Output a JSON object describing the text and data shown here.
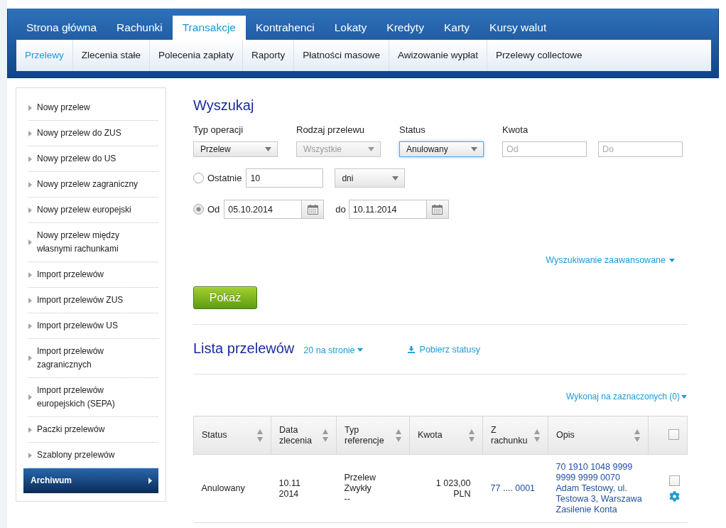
{
  "header": {
    "tabs": [
      {
        "label": "Strona główna",
        "selected": false
      },
      {
        "label": "Rachunki",
        "selected": false
      },
      {
        "label": "Transakcje",
        "selected": true
      },
      {
        "label": "Kontrahenci",
        "selected": false
      },
      {
        "label": "Lokaty",
        "selected": false
      },
      {
        "label": "Kredyty",
        "selected": false
      },
      {
        "label": "Karty",
        "selected": false
      },
      {
        "label": "Kursy walut",
        "selected": false
      }
    ],
    "subtabs": [
      {
        "label": "Przelewy",
        "selected": true
      },
      {
        "label": "Zlecenia stałe",
        "selected": false
      },
      {
        "label": "Polecenia zapłaty",
        "selected": false
      },
      {
        "label": "Raporty",
        "selected": false
      },
      {
        "label": "Płatności masowe",
        "selected": false
      },
      {
        "label": "Awizowanie wypłat",
        "selected": false
      },
      {
        "label": "Przelewy collectowe",
        "selected": false
      }
    ]
  },
  "sidebar": {
    "items": [
      {
        "label": "Nowy przelew",
        "selected": false
      },
      {
        "label": "Nowy przelew do ZUS",
        "selected": false
      },
      {
        "label": "Nowy przelew do US",
        "selected": false
      },
      {
        "label": "Nowy przelew zagraniczny",
        "selected": false
      },
      {
        "label": "Nowy przelew europejski",
        "selected": false
      },
      {
        "label": "Nowy przelew między własnymi rachunkami",
        "selected": false
      },
      {
        "label": "Import przelewów",
        "selected": false
      },
      {
        "label": "Import przelewów ZUS",
        "selected": false
      },
      {
        "label": "Import przelewów US",
        "selected": false
      },
      {
        "label": "Import przelewów zagranicznych",
        "selected": false
      },
      {
        "label": "Import przelewów europejskich (SEPA)",
        "selected": false
      },
      {
        "label": "Paczki przelewów",
        "selected": false
      },
      {
        "label": "Szablony przelewów",
        "selected": false
      },
      {
        "label": "Archiwum",
        "selected": true
      }
    ]
  },
  "search": {
    "title": "Wyszukaj",
    "filters": [
      {
        "kind": "select",
        "label": "Typ operacji",
        "value": "Przelew",
        "disabled": false,
        "focused": false
      },
      {
        "kind": "select",
        "label": "Rodzaj przelewu",
        "value": "Wszystkie",
        "disabled": true,
        "focused": false
      },
      {
        "kind": "select",
        "label": "Status",
        "value": "Anulowany",
        "disabled": false,
        "focused": true
      },
      {
        "kind": "range",
        "label": "Kwota",
        "from_placeholder": "Od",
        "to_placeholder": "Do"
      }
    ],
    "date_options": [
      {
        "kind": "last",
        "label": "Ostatnie",
        "selected": false,
        "value": "10",
        "unit": "dni"
      },
      {
        "kind": "range",
        "label": "Od",
        "selected": true,
        "from": "05.10.2014",
        "to_label": "do",
        "to": "10.11.2014"
      }
    ],
    "advanced_link": "Wyszukiwanie zaawansowane",
    "submit": "Pokaż"
  },
  "transfers": {
    "title": "Lista przelewów",
    "page_size": "20 na stronie",
    "download": "Pobierz statusy",
    "bulk_action": "Wykonaj na zaznaczonych (0)",
    "table": {
      "columns": [
        "Status",
        "Data zlecenia",
        "Typ referencje",
        "Kwota",
        "Z rachunku",
        "Opis"
      ],
      "select_all": {
        "checked": false
      },
      "rows": [
        {
          "status": "Anulowany",
          "date": [
            "10.11",
            "2014"
          ],
          "type": [
            "Przelew",
            "Zwykły",
            "--"
          ],
          "amount": [
            "1 023,00",
            "PLN"
          ],
          "account": "77 .... 0001",
          "description": [
            "70 1910 1048 9999",
            "9999 9999 0070",
            "Adam Testowy, ul.",
            "Testowa 3, Warszawa",
            "Zasilenie Konta"
          ],
          "checked": false
        }
      ]
    }
  }
}
